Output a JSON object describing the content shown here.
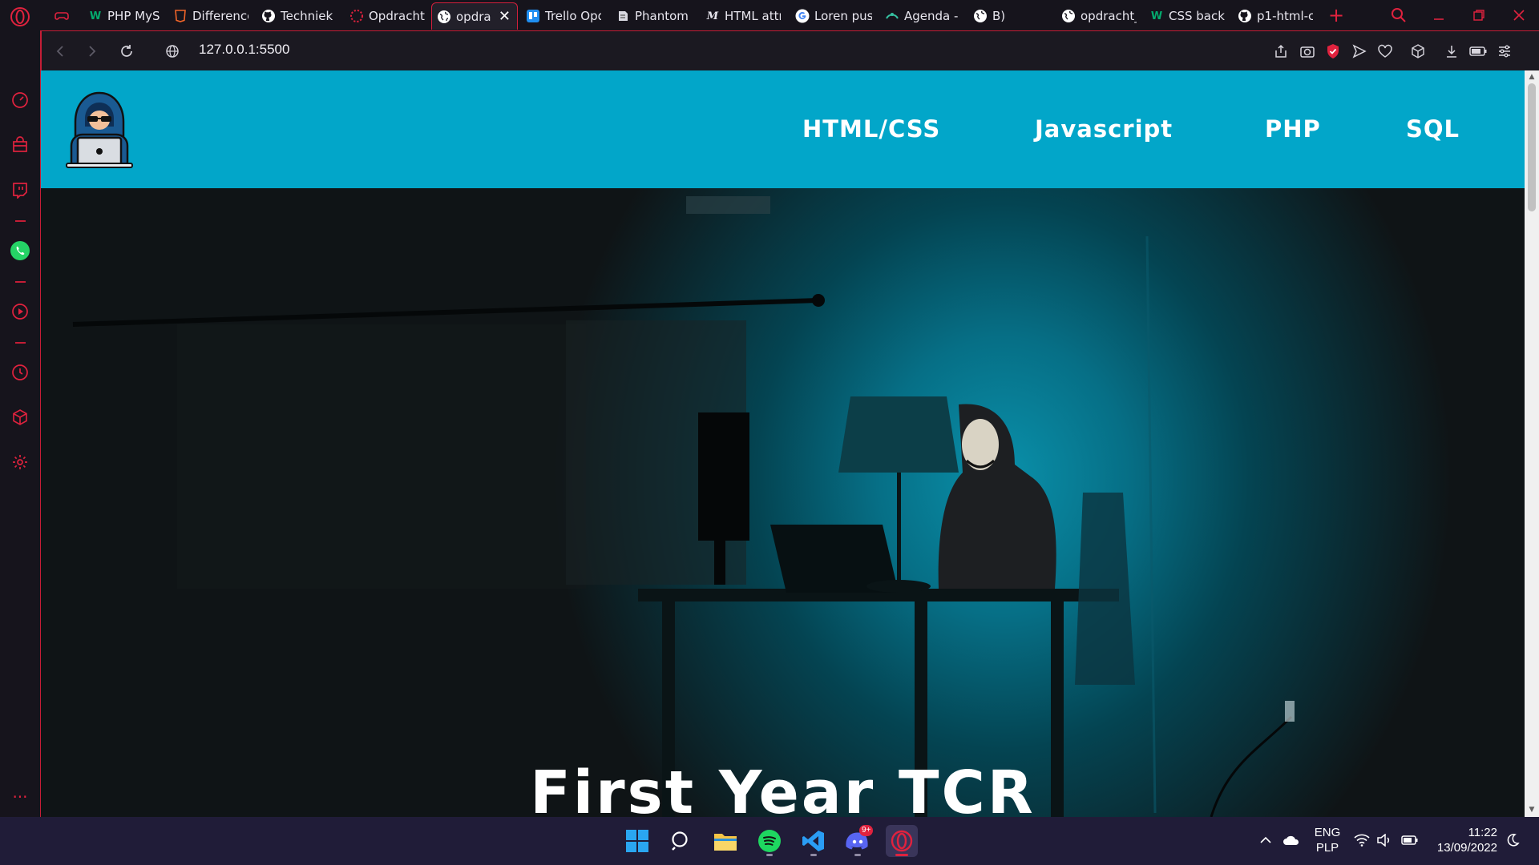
{
  "browser": {
    "tabs": [
      {
        "label": "",
        "icon": "gamepad-icon"
      },
      {
        "label": "PHP MySQ",
        "icon": "w3schools-icon"
      },
      {
        "label": "Difference",
        "icon": "html5-icon"
      },
      {
        "label": "TechniekC",
        "icon": "github-icon"
      },
      {
        "label": "Opdracht",
        "icon": "loader-icon"
      },
      {
        "label": "opdra",
        "icon": "globe-icon",
        "active": true
      },
      {
        "label": "Trello Opd",
        "icon": "trello-icon"
      },
      {
        "label": "Phantom",
        "icon": "doc-icon"
      },
      {
        "label": "HTML attr",
        "icon": "mdn-icon"
      },
      {
        "label": "Loren pus",
        "icon": "google-icon"
      },
      {
        "label": "Agenda -",
        "icon": "agenda-icon"
      },
      {
        "label": "B)",
        "icon": "globe-icon"
      },
      {
        "label": "opdracht_",
        "icon": "globe-icon"
      },
      {
        "label": "CSS backg",
        "icon": "w3schools-icon"
      },
      {
        "label": "p1-html-c",
        "icon": "github-icon"
      }
    ],
    "url": "127.0.0.1:5500",
    "accent_color": "#d2203c"
  },
  "website": {
    "nav": [
      "HTML/CSS",
      "Javascript",
      "PHP",
      "SQL"
    ],
    "hero_title": "First Year TCR",
    "header_color": "#02a6c9"
  },
  "taskbar": {
    "language": "ENG",
    "layout": "PLP",
    "time": "11:22",
    "date": "13/09/2022",
    "discord_badge": "9+"
  }
}
